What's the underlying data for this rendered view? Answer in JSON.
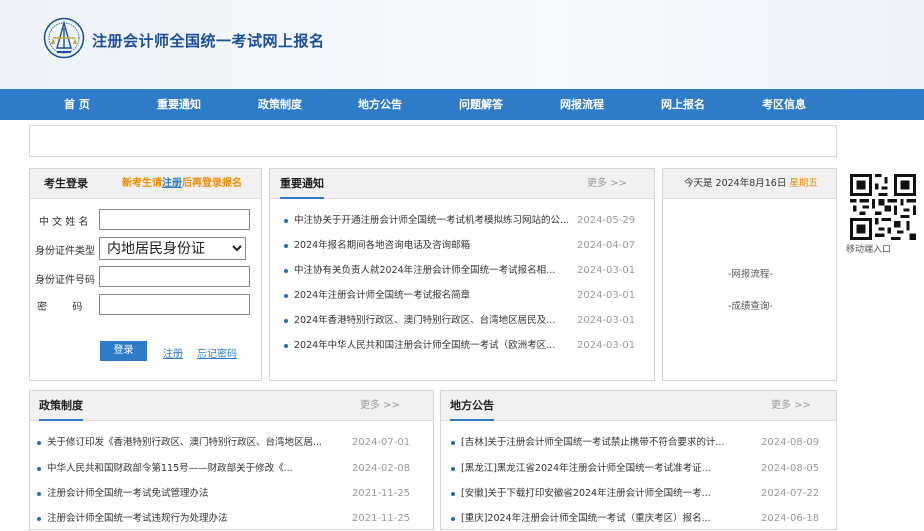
{
  "header": {
    "title": "注册会计师全国统一考试网上报名",
    "logo_icon": "cicpa-seal-icon"
  },
  "nav": {
    "items": [
      {
        "label": "首  页"
      },
      {
        "label": "重要通知"
      },
      {
        "label": "政策制度"
      },
      {
        "label": "地方公告"
      },
      {
        "label": "问题解答"
      },
      {
        "label": "网报流程"
      },
      {
        "label": "网上报名"
      },
      {
        "label": "考区信息"
      }
    ]
  },
  "login": {
    "title": "考生登录",
    "hint_before": "新考生请",
    "hint_link": "注册",
    "hint_after": "后再登录报名",
    "name_label": "中 文  姓 名",
    "id_type_label": "身份证件类型",
    "id_type_value": "内地居民身份证",
    "id_number_label": "身份证件号码",
    "password_label": "密        码",
    "login_button": "登录",
    "register_link": "注册",
    "forgot_link": "忘记密码"
  },
  "notices": {
    "title": "重要通知",
    "more": "更多 >>",
    "items": [
      {
        "text": "中注协关于开通注册会计师全国统一考试机考模拟练习网站的公...",
        "date": "2024-05-29"
      },
      {
        "text": "2024年报名期间各地咨询电话及咨询邮箱",
        "date": "2024-04-07"
      },
      {
        "text": "中注协有关负责人就2024年注册会计师全国统一考试报名相...",
        "date": "2024-03-01"
      },
      {
        "text": "2024年注册会计师全国统一考试报名简章",
        "date": "2024-03-01"
      },
      {
        "text": "2024年香港特别行政区、澳门特别行政区、台湾地区居民及...",
        "date": "2024-03-01"
      },
      {
        "text": "2024年中华人民共和国注册会计师全国统一考试（欧洲考区...",
        "date": "2024-03-01"
      }
    ]
  },
  "today": {
    "prefix": "今天是 2024年8月16日 ",
    "weekday": "星期五",
    "weekday_color": "#f08c00",
    "links": [
      "-网报流程-",
      "-成绩查询-"
    ]
  },
  "qr": {
    "icon": "qr-code-icon",
    "label": "移动端入口"
  },
  "policy": {
    "title": "政策制度",
    "more": "更多 >>",
    "items": [
      {
        "text": "关于修订印发《香港特别行政区、澳门特别行政区、台湾地区居...",
        "date": "2024-07-01"
      },
      {
        "text": "中华人民共和国财政部令第115号——财政部关于修改《...",
        "date": "2024-02-08"
      },
      {
        "text": "注册会计师全国统一考试免试管理办法",
        "date": "2021-11-25"
      },
      {
        "text": "注册会计师全国统一考试违规行为处理办法",
        "date": "2021-11-25"
      }
    ]
  },
  "local": {
    "title": "地方公告",
    "more": "更多 >>",
    "items": [
      {
        "text": "[吉林]关于注册会计师全国统一考试禁止携带不符合要求的计...",
        "date": "2024-08-09"
      },
      {
        "text": "[黑龙江]黑龙江省2024年注册会计师全国统一考试准考证...",
        "date": "2024-08-05"
      },
      {
        "text": "[安徽]关于下载打印安徽省2024年注册会计师全国统一考...",
        "date": "2024-07-22"
      },
      {
        "text": "[重庆]2024年注册会计师全国统一考试（重庆考区）报名...",
        "date": "2024-06-18"
      }
    ]
  }
}
